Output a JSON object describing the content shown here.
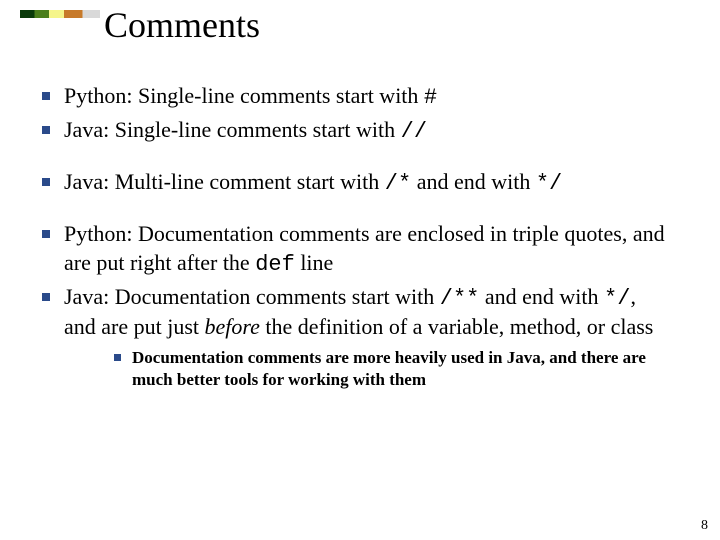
{
  "title": "Comments",
  "bullets": {
    "b1": {
      "pre": "Python: Single-line comments start with ",
      "code": "#"
    },
    "b2": {
      "pre": "Java: Single-line comments start with ",
      "code": "//"
    },
    "b3": {
      "pre": "Java:  Multi-line comment start with ",
      "code1": "/*",
      "mid": " and end with ",
      "code2": "*/"
    },
    "b4": {
      "pre": "Python: Documentation comments are enclosed in triple quotes, and are put right after the ",
      "code": "def",
      "post": " line"
    },
    "b5": {
      "pre": "Java: Documentation comments start with ",
      "code1": "/**",
      "mid1": " and end with ",
      "code2": "*/",
      "mid2": ", and are put just ",
      "ital": "before",
      "post": " the definition of a variable, method, or class"
    },
    "sub1": "Documentation comments are more heavily used in Java, and there are much better tools for working with them"
  },
  "page_number": "8"
}
